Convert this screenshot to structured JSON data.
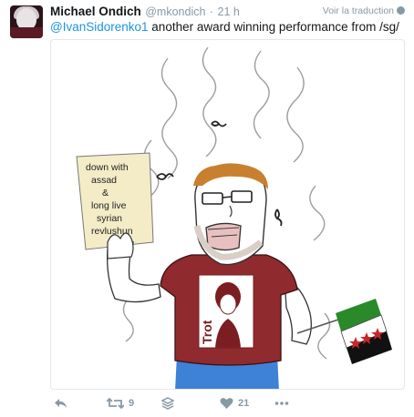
{
  "tweet": {
    "author": {
      "display_name": "Michael Ondich",
      "handle": "@mkondich",
      "separator": "·",
      "time": "21 h"
    },
    "translate_label": "Voir la traduction",
    "reply_to": "@IvanSidorenko1",
    "text": "another award winning performance from /sg/"
  },
  "image": {
    "sign_lines": [
      "down with",
      "assad",
      "&",
      "long live",
      "syrian",
      "revlushun"
    ],
    "shirt_text": "Trot"
  },
  "actions": {
    "reply_icon": "reply-icon",
    "retweet_icon": "retweet-icon",
    "retweet_count": "9",
    "stack_icon": "layers-icon",
    "like_icon": "heart-icon",
    "like_count": "21",
    "more_icon": "more-icon"
  },
  "colors": {
    "link": "#1b95e0",
    "muted": "#8899a6",
    "shirt": "#8f2a2e",
    "shorts": "#3d82d6",
    "flag_green": "#2a8a2a",
    "flag_black": "#111111",
    "flag_star": "#c62828"
  }
}
